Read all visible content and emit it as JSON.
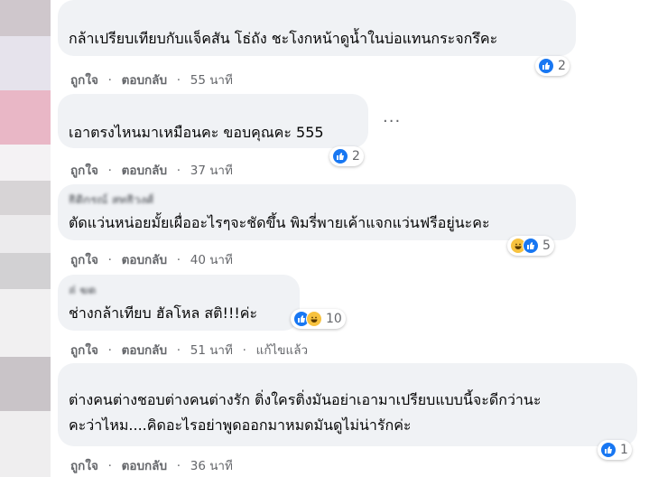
{
  "comments": [
    {
      "author": "",
      "text_lines": [
        "กล้าเปรียบเทียบกับแจ็คสัน โธ่ถัง ชะโงกหน้าดูน้ำในบ่อแทนกระจกรึคะ"
      ],
      "like_label": "ถูกใจ",
      "reply_label": "ตอบกลับ",
      "time": "55 นาที",
      "reaction_count": "2",
      "reactions": [
        "like-icon"
      ]
    },
    {
      "author": "",
      "text_lines": [
        "เอาตรงไหนมาเหมือนคะ ขอบคุณคะ 555"
      ],
      "like_label": "ถูกใจ",
      "reply_label": "ตอบกลับ",
      "time": "37 นาที",
      "reaction_count": "2",
      "reactions": [
        "like-icon"
      ]
    },
    {
      "author": "ธิดิกรณ์ สุทธิวงศ์",
      "text_lines": [
        "ตัดแว่นหน่อยมั้ยเผื่ออะไรๆจะชัดขึ้น พิมรี่พายเค้าแจกแว่นฟรีอยู่นะคะ"
      ],
      "like_label": "ถูกใจ",
      "reply_label": "ตอบกลับ",
      "time": "40 นาที",
      "reaction_count": "5",
      "reactions": [
        "haha-icon",
        "like-icon"
      ]
    },
    {
      "author": "อุ่ ฆดุ",
      "text_lines": [
        "ช่างกล้าเทียบ ฮัลโหล สติ!!!ค่ะ"
      ],
      "like_label": "ถูกใจ",
      "reply_label": "ตอบกลับ",
      "time": "51 นาที",
      "edited_label": "แก้ไขแล้ว",
      "reaction_count": "10",
      "reactions": [
        "like-icon",
        "haha-icon"
      ]
    },
    {
      "author": "",
      "text_lines": [
        "ต่างคนต่างชอบต่างคนต่างรัก ติ่งใครติ่งมันอย่าเอามาเปรียบแบบนี้จะดีกว่านะ",
        "คะว่าไหม....คิดอะไรอย่าพูดออกมาหมดมันดูไม่น่ารักค่ะ"
      ],
      "like_label": "ถูกใจ",
      "reply_label": "ตอบกลับ",
      "time": "36 นาที",
      "reaction_count": "1",
      "reactions": [
        "like-icon"
      ]
    }
  ],
  "separator": "·",
  "more_options_label": "···",
  "colors": {
    "bubble": "#f0f2f5",
    "like": "#1877f2",
    "haha": "#f7c23f",
    "meta": "#65676b"
  }
}
